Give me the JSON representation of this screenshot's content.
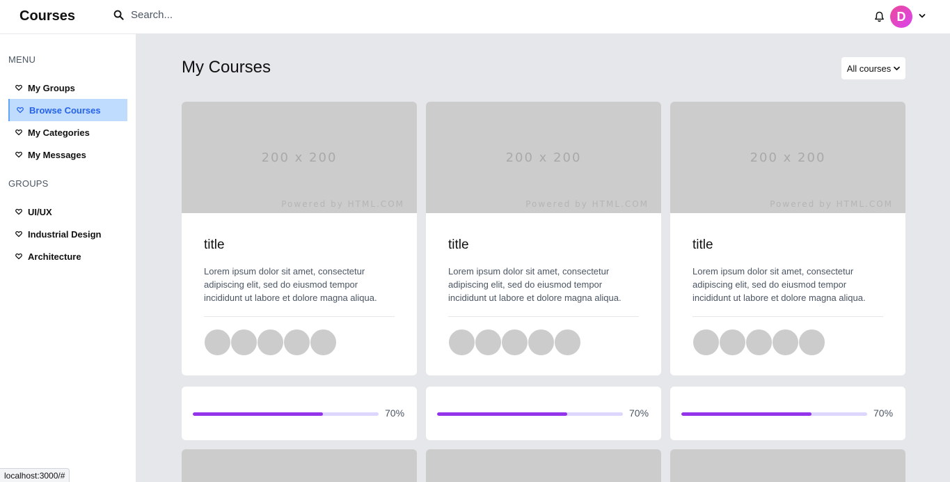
{
  "header": {
    "brand": "Courses",
    "search_placeholder": "Search...",
    "avatar_initial": "D"
  },
  "sidebar": {
    "menu_title": "MENU",
    "menu_items": [
      {
        "label": "My Groups",
        "active": false
      },
      {
        "label": "Browse Courses",
        "active": true
      },
      {
        "label": "My Categories",
        "active": false
      },
      {
        "label": "My Messages",
        "active": false
      }
    ],
    "groups_title": "GROUPS",
    "group_items": [
      {
        "label": "UI/UX"
      },
      {
        "label": "Industrial Design"
      },
      {
        "label": "Architecture"
      }
    ]
  },
  "main": {
    "title": "My Courses",
    "filter_label": "All courses",
    "cards": [
      {
        "thumb_text": "200 x 200",
        "thumb_sub": "Powered by HTML.COM",
        "title": "title",
        "description": "Lorem ipsum dolor sit amet, consectetur adipiscing elit, sed do eiusmod tempor incididunt ut labore et dolore magna aliqua.",
        "progress": 0.7,
        "progress_label": "70%"
      },
      {
        "thumb_text": "200 x 200",
        "thumb_sub": "Powered by HTML.COM",
        "title": "title",
        "description": "Lorem ipsum dolor sit amet, consectetur adipiscing elit, sed do eiusmod tempor incididunt ut labore et dolore magna aliqua.",
        "progress": 0.7,
        "progress_label": "70%"
      },
      {
        "thumb_text": "200 x 200",
        "thumb_sub": "Powered by HTML.COM",
        "title": "title",
        "description": "Lorem ipsum dolor sit amet, consectetur adipiscing elit, sed do eiusmod tempor incididunt ut labore et dolore magna aliqua.",
        "progress": 0.7,
        "progress_label": "70%"
      }
    ]
  },
  "status_bar": {
    "url": "localhost:3000/#"
  },
  "colors": {
    "accent": "#9333ea",
    "accent_light": "#ddd6fe",
    "active_nav_bg": "#bfdbfe",
    "active_nav_text": "#2563eb",
    "avatar_gradient_start": "#ec4899",
    "avatar_gradient_end": "#d946ef"
  }
}
